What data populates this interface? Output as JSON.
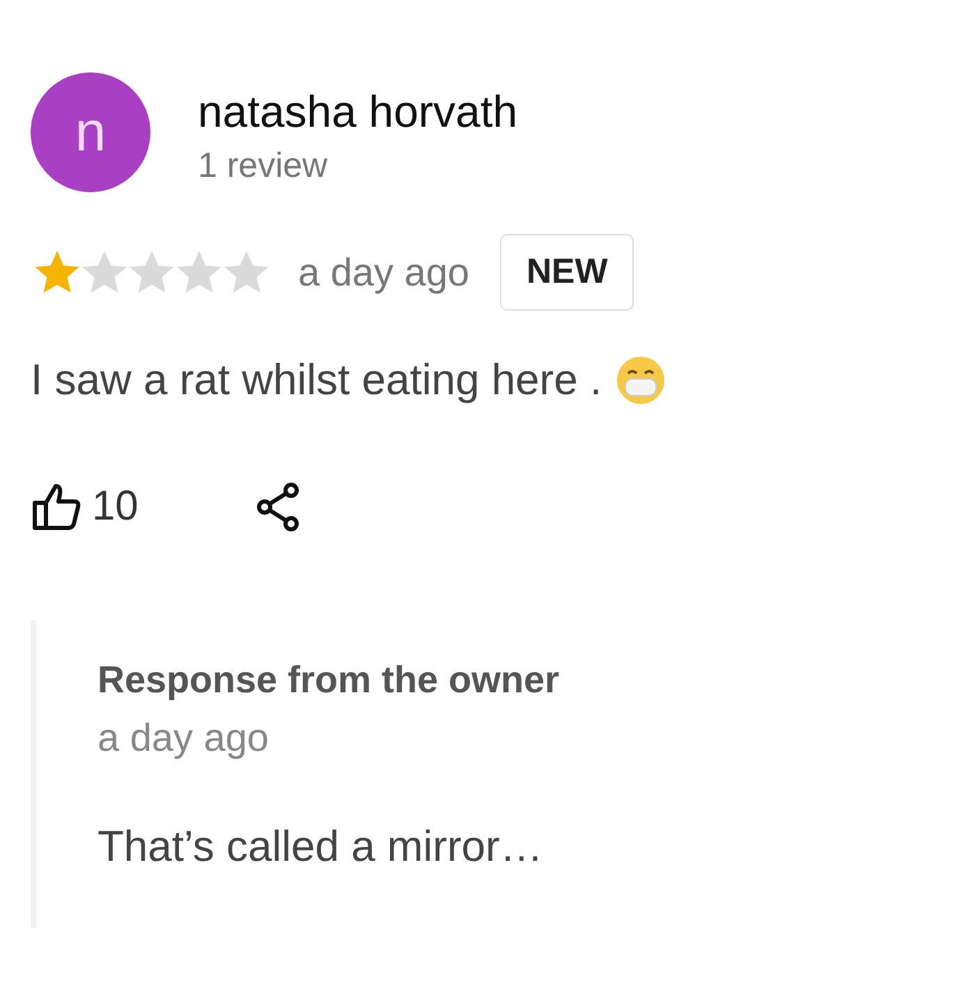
{
  "review": {
    "avatar_letter": "n",
    "author": "natasha horvath",
    "review_count": "1 review",
    "stars": 1,
    "time": "a day ago",
    "badge": "NEW",
    "text": "I saw a rat whilst eating here .",
    "likes": "10"
  },
  "owner_response": {
    "title": "Response from the owner",
    "time": "a day ago",
    "text": "That’s called a mirror…"
  }
}
